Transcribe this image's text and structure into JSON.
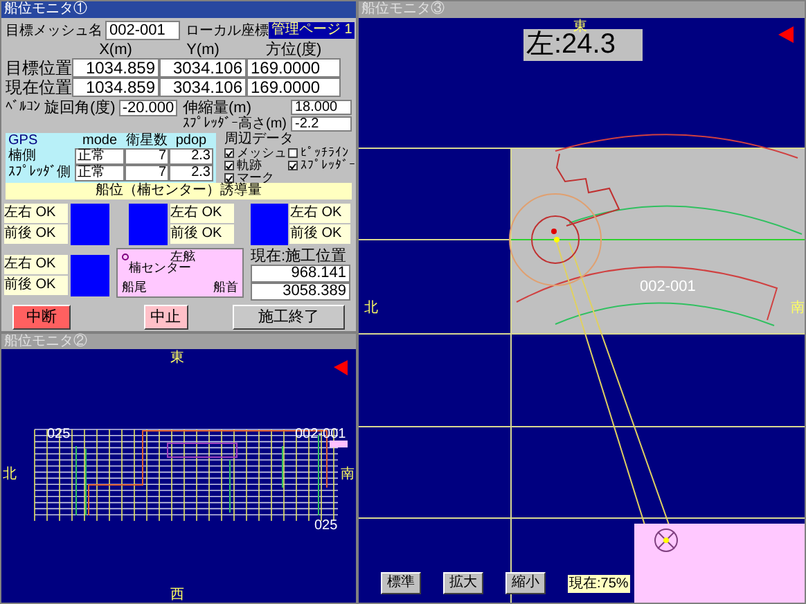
{
  "top_left_window": {
    "title": "船位モニタ①",
    "mesh_label": "目標メッシュ名",
    "mesh_value": "002-001",
    "coord_mode": "ローカル座標",
    "page_badge": "管理ページ 1",
    "position_columns": [
      "X(m)",
      "Y(m)",
      "方位(度)"
    ],
    "position_rows": [
      {
        "label": "目標位置",
        "values": [
          "1034.859",
          "3034.106",
          "169.0000"
        ]
      },
      {
        "label": "現在位置",
        "values": [
          "1034.859",
          "3034.106",
          "169.0000"
        ]
      }
    ],
    "belcon_label": "ﾍﾞﾙｺﾝ",
    "slew_label": "旋回角(度)",
    "slew_value": "-20.000",
    "extend_label": "伸縮量(m)",
    "extend_value": "18.000",
    "spreader_height_label": "ｽﾌﾟﾚｯﾀﾞｰ高さ(m)",
    "spreader_height_value": "-2.2",
    "gps": {
      "title": "GPS",
      "columns": [
        "mode",
        "衛星数",
        "pdop"
      ],
      "rows": [
        {
          "label": "楠側",
          "values": [
            "正常",
            "7",
            "2.3"
          ]
        },
        {
          "label": "ｽﾌﾟﾚｯﾀﾞ側",
          "values": [
            "正常",
            "7",
            "2.3"
          ]
        }
      ]
    },
    "surroundings": {
      "title": "周辺データ",
      "options": [
        {
          "label": "メッシュ",
          "checked": true
        },
        {
          "label": "ﾋﾟｯﾁﾗｲﾝ",
          "checked": false
        },
        {
          "label": "軌跡",
          "checked": true
        },
        {
          "label": "ｽﾌﾟﾚｯﾀﾞｰ",
          "checked": true
        },
        {
          "label": "マーク",
          "checked": true
        }
      ]
    },
    "guidance_title": "船位（楠センター）誘導量",
    "guidance": [
      {
        "kind": "labels_left",
        "lines": [
          "左右 OK",
          "前後 OK"
        ]
      },
      {
        "kind": "labels_right",
        "lines": [
          "左右 OK",
          "前後 OK"
        ]
      },
      {
        "kind": "labels_right",
        "lines": [
          "左右 OK",
          "前後 OK"
        ]
      },
      {
        "kind": "labels_left",
        "lines": [
          "左右 OK",
          "前後 OK"
        ]
      }
    ],
    "ship_diagram": {
      "port": "左舷",
      "center": "楠センター",
      "stern": "船尾",
      "bow": "船首"
    },
    "current_label": "現在:施工位置",
    "current_values": [
      "968.141",
      "3058.389"
    ],
    "buttons": [
      {
        "label": "中断",
        "kind": "danger"
      },
      {
        "label": "中止",
        "kind": "warning"
      },
      {
        "label": "施工終了",
        "kind": "normal"
      }
    ]
  },
  "bottom_left_window": {
    "title": "船位モニタ②",
    "compass": {
      "east": "東",
      "north": "北",
      "south": "南",
      "west": "西"
    },
    "grid_labels": [
      "025",
      "002-001",
      "025"
    ]
  },
  "right_window": {
    "title": "船位モニタ③",
    "offset_reading": "左:24.3",
    "compass": {
      "east": "東",
      "north": "北",
      "south": "南"
    },
    "mesh_label": "002-001",
    "zoom_buttons": [
      "標準",
      "拡大",
      "縮小"
    ],
    "zoom_reading": "現在:75%"
  }
}
